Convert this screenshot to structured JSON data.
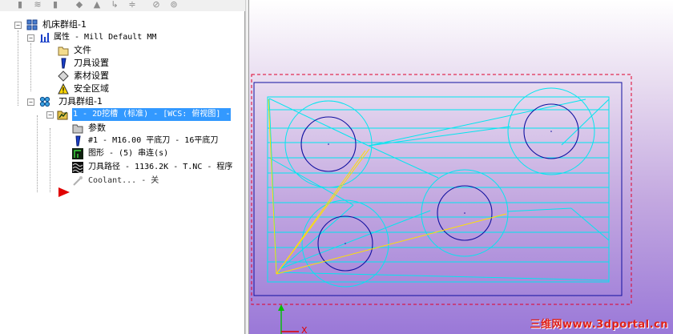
{
  "toolbar": {
    "icons": [
      "select-all-icon",
      "regen-icon",
      "toggle-icon",
      "verify-icon",
      "up-icon",
      "insert-icon",
      "expand-icon",
      "lock-icon",
      "display-icon"
    ]
  },
  "tree": {
    "machine_group": "机床群组-1",
    "properties": "属性 - Mill Default MM",
    "files": "文件",
    "tool_settings": "刀具设置",
    "stock_setup": "素材设置",
    "safety_zone": "安全区域",
    "toolpath_group": "刀具群组-1",
    "operation": "1 - 2D挖槽 (标准) - [WCS: 俯视图] -",
    "parameters": "参数",
    "tool": "#1 - M16.00 平底刀 - 16平底刀",
    "geometry": "图形 - (5) 串连(s)",
    "toolpath": "刀具路径 - 1136.2K - T.NC - 程序",
    "coolant": "Coolant... - 关"
  },
  "viewport": {
    "watermark": "三维网www.3dportal.cn",
    "axis_x": "X",
    "colors": {
      "geometry": "#1010a0",
      "toolpath": "#00e6ef",
      "rapid": "#ffe000",
      "stock": "#e0002a"
    }
  }
}
